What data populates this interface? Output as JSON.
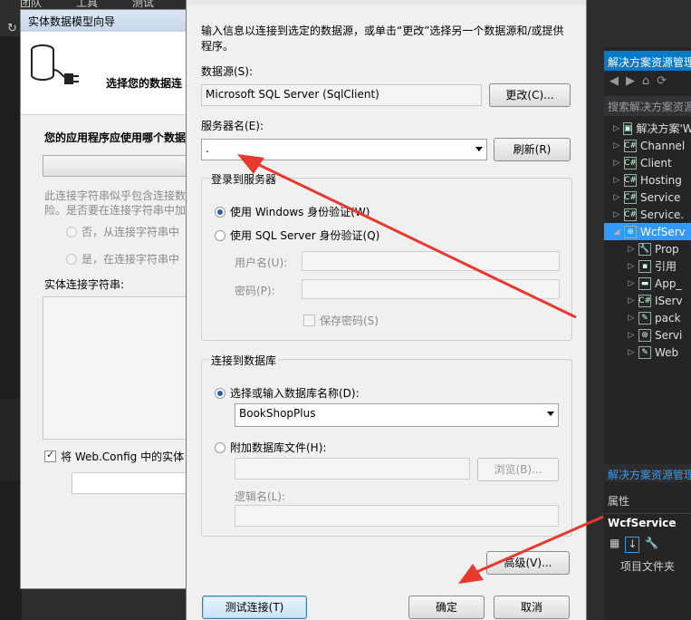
{
  "vs": {
    "menu": [
      "团队",
      "工具",
      "测试"
    ]
  },
  "wizard": {
    "title": "实体数据模型向导",
    "header_text": "选择您的数据连",
    "question": "您的应用程序应使用哪个数据",
    "sensitive_line1": "此连接字符串似乎包含连接数",
    "sensitive_line2": "险。是否要在连接字符串中加",
    "option_no": "否，从连接字符串中",
    "option_yes": "是，在连接字符串中",
    "entity_conn_label": "实体连接字符串:",
    "save_webconfig": "将 Web.Config 中的实体"
  },
  "dialog": {
    "intro": "输入信息以连接到选定的数据源，或单击“更改”选择另一个数据源和/或提供程序。",
    "datasource_label": "数据源(S):",
    "datasource_value": "Microsoft SQL Server (SqlClient)",
    "change_button": "更改(C)...",
    "server_label": "服务器名(E):",
    "server_value": ".",
    "refresh_button": "刷新(R)",
    "login_group": "登录到服务器",
    "windows_auth": "使用 Windows 身份验证(W)",
    "sql_auth": "使用 SQL Server 身份验证(Q)",
    "username_label": "用户名(U):",
    "password_label": "密码(P):",
    "save_password": "保存密码(S)",
    "db_group": "连接到数据库",
    "select_db_label": "选择或输入数据库名称(D):",
    "db_value": "BookShopPlus",
    "attach_label": "附加数据库文件(H):",
    "browse_button": "浏览(B)...",
    "logical_label": "逻辑名(L):",
    "advanced_button": "高级(V)...",
    "test_button": "测试连接(T)",
    "ok_button": "确定",
    "cancel_button": "取消"
  },
  "solution_explorer": {
    "title": "解决方案资源管理器",
    "search": "搜索解决方案资源管",
    "items": [
      {
        "label": "解决方案'W",
        "indent": 0,
        "icon": "solution-icon"
      },
      {
        "label": "Channel",
        "indent": 0,
        "icon": "csharp-project-icon"
      },
      {
        "label": "Client",
        "indent": 0,
        "icon": "csharp-project-icon"
      },
      {
        "label": "Hosting",
        "indent": 0,
        "icon": "csharp-project-icon"
      },
      {
        "label": "Service",
        "indent": 0,
        "icon": "csharp-project-icon"
      },
      {
        "label": "Service.",
        "indent": 0,
        "icon": "csharp-project-icon"
      },
      {
        "label": "WcfServ",
        "indent": 0,
        "icon": "web-project-icon",
        "selected": true
      },
      {
        "label": "Prop",
        "indent": 1,
        "icon": "wrench-icon"
      },
      {
        "label": "引用",
        "indent": 1,
        "icon": "references-icon"
      },
      {
        "label": "App_",
        "indent": 1,
        "icon": "folder-icon"
      },
      {
        "label": "IServ",
        "indent": 1,
        "icon": "csharp-file-icon"
      },
      {
        "label": "pack",
        "indent": 1,
        "icon": "config-icon"
      },
      {
        "label": "Servi",
        "indent": 1,
        "icon": "service-icon"
      },
      {
        "label": "Web",
        "indent": 1,
        "icon": "config-icon"
      }
    ],
    "bottom_tab": "解决方案资源管理",
    "properties_title": "属性",
    "properties_object": "WcfService",
    "properties_row": "项目文件夹"
  },
  "colors": {
    "accent": "#007acc",
    "selection": "#3399ff",
    "arrow": "#e8392f"
  }
}
